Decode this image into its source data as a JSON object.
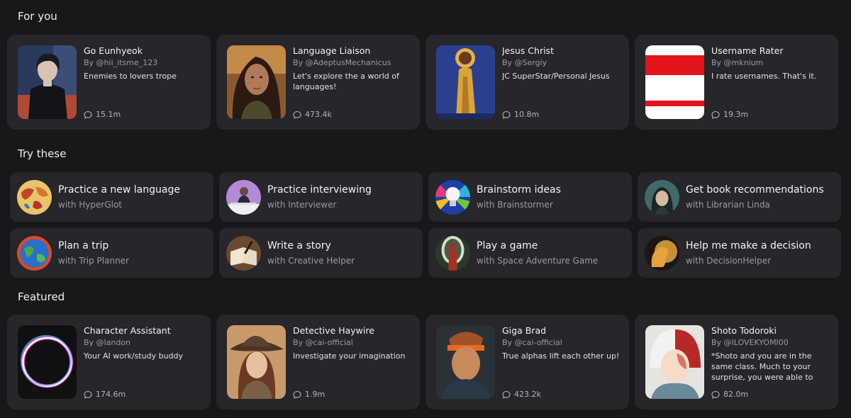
{
  "sections": {
    "for_you": "For you",
    "try_these": "Try these",
    "featured": "Featured"
  },
  "for_you": [
    {
      "name": "Go Eunhyeok",
      "author": "By @hii_itsme_123",
      "desc": "Enemies to lovers trope",
      "chats": "15.1m",
      "avatar": "dark-haired-man"
    },
    {
      "name": "Language Liaison",
      "author": "By @AdeptusMechanicus",
      "desc": "Let's explore the a world of languages!",
      "chats": "473.4k",
      "avatar": "woman-portrait"
    },
    {
      "name": "Jesus Christ",
      "author": "By @Sergiy",
      "desc": "JC SuperStar/Personal Jesus",
      "chats": "10.8m",
      "avatar": "golden-robed-figure"
    },
    {
      "name": "Username Rater",
      "author": "By @mknium",
      "desc": "I rate usernames. That's it.",
      "chats": "19.3m",
      "avatar": "hello-name-tag"
    }
  ],
  "try_these": [
    {
      "title": "Practice a new language",
      "sub": "with HyperGlot",
      "avatar": "world-map"
    },
    {
      "title": "Practice interviewing",
      "sub": "with Interviewer",
      "avatar": "interviewer"
    },
    {
      "title": "Brainstorm ideas",
      "sub": "with Brainstormer",
      "avatar": "lightbulb"
    },
    {
      "title": "Get book recommendations",
      "sub": "with Librarian Linda",
      "avatar": "librarian"
    },
    {
      "title": "Plan a trip",
      "sub": "with Trip Planner",
      "avatar": "globe"
    },
    {
      "title": "Write a story",
      "sub": "with Creative Helper",
      "avatar": "open-book"
    },
    {
      "title": "Play a game",
      "sub": "with Space Adventure Game",
      "avatar": "astronaut"
    },
    {
      "title": "Help me make a decision",
      "sub": "with DecisionHelper",
      "avatar": "glowing-head"
    }
  ],
  "featured": [
    {
      "name": "Character Assistant",
      "author": "By @landon",
      "desc": "Your AI work/study buddy",
      "chats": "174.6m",
      "avatar": "neon-ring"
    },
    {
      "name": "Detective Haywire",
      "author": "By @cai-official",
      "desc": "Investigate your imagination",
      "chats": "1.9m",
      "avatar": "detective"
    },
    {
      "name": "Giga Brad",
      "author": "By @cai-official",
      "desc": "True alphas lift each other up!",
      "chats": "423.2k",
      "avatar": "headband-man"
    },
    {
      "name": "Shoto Todoroki",
      "author": "By @ILOVEKYOMI00",
      "desc": "*Shoto and you are in the same class. Much to your surprise, you were able to befriend the...",
      "chats": "82.0m",
      "avatar": "anime-boy"
    }
  ],
  "colors": {
    "background": "#18181b",
    "card": "#26262b",
    "muted_text": "#9a9aa2"
  }
}
